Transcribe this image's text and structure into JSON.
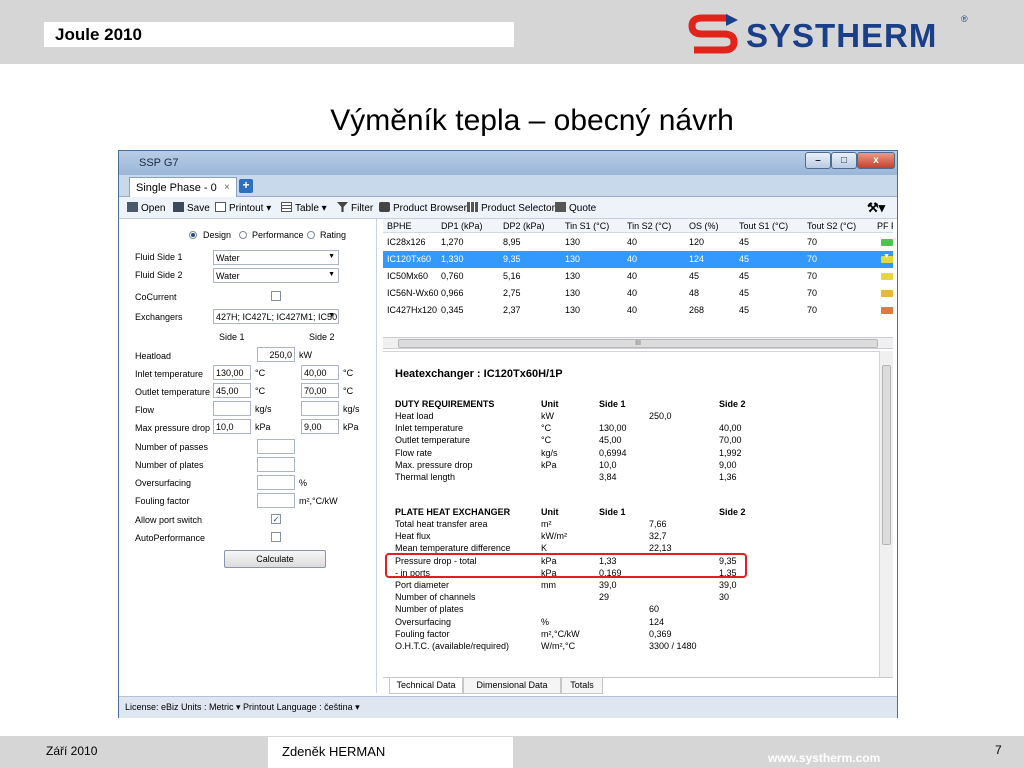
{
  "slide": {
    "header_title": "Joule 2010",
    "logo_text": "SYSTHERM",
    "logo_reg": "®",
    "title": "Výměník tepla – obecný návrh",
    "footer_date": "Září 2010",
    "footer_author": "Zdeněk HERMAN",
    "footer_url": "www.systherm.com",
    "footer_page": "7"
  },
  "window": {
    "title": "SSP G7",
    "tab_label": "Single Phase - 0",
    "tab_close": "×",
    "tab_add": "+",
    "controls": {
      "minimize": "–",
      "maximize": "□",
      "close": "x"
    }
  },
  "toolbar": {
    "open": "Open",
    "save": "Save",
    "printout": "Printout ▾",
    "table": "Table ▾",
    "filter": "Filter",
    "product_browser": "Product Browser",
    "product_selector": "Product Selector",
    "quote": "Quote",
    "tools": "⚒▾"
  },
  "left_panel": {
    "modes": [
      "Design",
      "Performance",
      "Rating"
    ],
    "selected_mode": "Design",
    "fluid_side1_label": "Fluid Side 1",
    "fluid_side1_value": "Water",
    "fluid_side2_label": "Fluid Side 2",
    "fluid_side2_value": "Water",
    "cocurrent_label": "CoCurrent",
    "exchangers_label": "Exchangers",
    "exchangers_value": "427H; IC427L; IC427M1; IC50",
    "side1_header": "Side 1",
    "side2_header": "Side 2",
    "heatload_label": "Heatload",
    "heatload_value": "250,0",
    "heatload_unit": "kW",
    "inlet_label": "Inlet temperature",
    "inlet_s1": "130,00",
    "inlet_s2": "40,00",
    "outlet_label": "Outlet temperature",
    "outlet_s1": "45,00",
    "outlet_s2": "70,00",
    "temp_unit": "°C",
    "flow_label": "Flow",
    "flow_unit": "kg/s",
    "maxdp_label": "Max pressure drop",
    "maxdp_s1": "10,0",
    "maxdp_s2": "9,00",
    "pressure_unit": "kPa",
    "passes_label": "Number of passes",
    "plates_label": "Number of plates",
    "oversurfacing_label": "Oversurfacing",
    "oversurfacing_unit": "%",
    "fouling_label": "Fouling factor",
    "fouling_unit": "m²,°C/kW",
    "portswitch_label": "Allow port switch",
    "autoperf_label": "AutoPerformance",
    "calculate": "Calculate",
    "check_mark": "✓"
  },
  "grid": {
    "headers": [
      "BPHE",
      "DP1 (kPa)",
      "DP2 (kPa)",
      "Tin S1 (°C)",
      "Tin S2 (°C)",
      "OS (%)",
      "Tout S1 (°C)",
      "Tout S2 (°C)",
      "PF F"
    ],
    "rows": [
      [
        "IC28x126",
        "1,270",
        "8,95",
        "130",
        "40",
        "120",
        "45",
        "70"
      ],
      [
        "IC120Tx60",
        "1,330",
        "9,35",
        "130",
        "40",
        "124",
        "45",
        "70"
      ],
      [
        "IC50Mx60",
        "0,760",
        "5,16",
        "130",
        "40",
        "45",
        "45",
        "70"
      ],
      [
        "IC56N-Wx60",
        "0,966",
        "2,75",
        "130",
        "40",
        "48",
        "45",
        "70"
      ],
      [
        "IC427Hx120",
        "0,345",
        "2,37",
        "130",
        "40",
        "268",
        "45",
        "70"
      ]
    ],
    "pf_colors": [
      "#4fc34f",
      "#e6d640",
      "#e6d640",
      "#e6b840",
      "#e07a3a"
    ],
    "selected_row": 1,
    "scroll_mark": "III"
  },
  "report": {
    "title": "Heatexchanger : IC120Tx60H/1P",
    "duty_header": [
      "DUTY REQUIREMENTS",
      "Unit",
      "Side 1",
      "",
      "Side 2"
    ],
    "duty_rows": [
      [
        "Heat load",
        "kW",
        "",
        "250,0",
        ""
      ],
      [
        "Inlet temperature",
        "°C",
        "130,00",
        "",
        "40,00"
      ],
      [
        "Outlet temperature",
        "°C",
        "45,00",
        "",
        "70,00"
      ],
      [
        "Flow rate",
        "kg/s",
        "0,6994",
        "",
        "1,992"
      ],
      [
        "Max. pressure drop",
        "kPa",
        "10,0",
        "",
        "9,00"
      ],
      [
        "Thermal length",
        "",
        "3,84",
        "",
        "1,36"
      ]
    ],
    "plate_header": [
      "PLATE HEAT EXCHANGER",
      "Unit",
      "Side 1",
      "",
      "Side 2"
    ],
    "plate_rows": [
      [
        "Total heat transfer area",
        "m²",
        "",
        "7,66",
        ""
      ],
      [
        "Heat flux",
        "kW/m²",
        "",
        "32,7",
        ""
      ],
      [
        "Mean temperature difference",
        "K",
        "",
        "22,13",
        ""
      ],
      [
        "Pressure drop - total",
        "kPa",
        "1,33",
        "",
        "9,35"
      ],
      [
        "- in ports",
        "kPa",
        "0,169",
        "",
        "1,35"
      ],
      [
        "Port diameter",
        "mm",
        "39,0",
        "",
        "39,0"
      ],
      [
        "Number of channels",
        "",
        "29",
        "",
        "30"
      ],
      [
        "Number of plates",
        "",
        "",
        "60",
        ""
      ],
      [
        "Oversurfacing",
        "%",
        "",
        "124",
        ""
      ],
      [
        "Fouling factor",
        "m²,°C/kW",
        "",
        "0,369",
        ""
      ],
      [
        "O.H.T.C. (available/required)",
        "W/m²,°C",
        "",
        "3300 / 1480",
        ""
      ]
    ],
    "tabs": [
      "Technical Data",
      "Dimensional Data",
      "Totals"
    ]
  },
  "statusbar": {
    "text": "License: eBiz  Units : Metric ▾  Printout Language : čeština ▾"
  }
}
